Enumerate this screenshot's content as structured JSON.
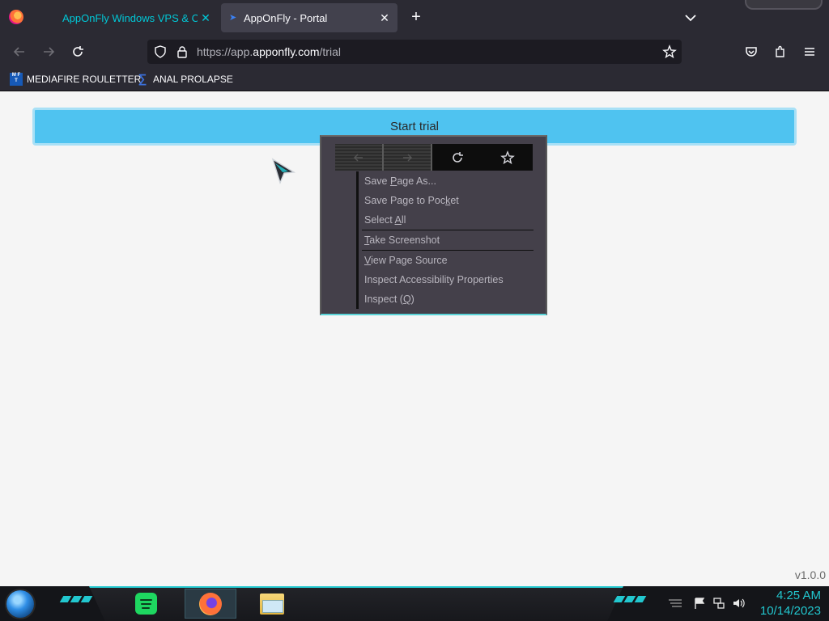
{
  "browser": {
    "tabs": [
      {
        "label": "AppOnFly Windows VPS & Clo",
        "active": false,
        "color": "#00c8d7"
      },
      {
        "label": "AppOnFly - Portal",
        "active": true
      }
    ],
    "url": {
      "prefix": "https://app.",
      "domain": "apponfly.com",
      "path": "/trial"
    },
    "bookmarks": [
      {
        "label": "MEDIAFIRE ROULETTER",
        "icon": "mediafire-icon"
      },
      {
        "label": "ANAL PROLAPSE",
        "icon": "sigma-icon"
      }
    ]
  },
  "page": {
    "start_trial_label": "Start trial",
    "version": "v1.0.0",
    "accent": "#4fc3f0"
  },
  "context_menu": {
    "toolbar": [
      "back-icon",
      "forward-icon",
      "reload-icon",
      "bookmark-star-icon"
    ],
    "items": [
      {
        "before": "Save ",
        "key": "P",
        "after": "age As..."
      },
      {
        "before": "Save Page to Poc",
        "key": "k",
        "after": "et"
      },
      {
        "before": "Select ",
        "key": "A",
        "after": "ll"
      },
      {
        "before": "",
        "key": "T",
        "after": "ake Screenshot"
      },
      {
        "before": "",
        "key": "V",
        "after": "iew Page Source"
      },
      {
        "before": "Inspect Accessibility Properties",
        "key": "",
        "after": ""
      },
      {
        "before": "Inspect (",
        "key": "Q",
        "after": ")"
      }
    ]
  },
  "taskbar": {
    "time": "4:25 AM",
    "date": "10/14/2023",
    "accent": "#22c7cf"
  }
}
